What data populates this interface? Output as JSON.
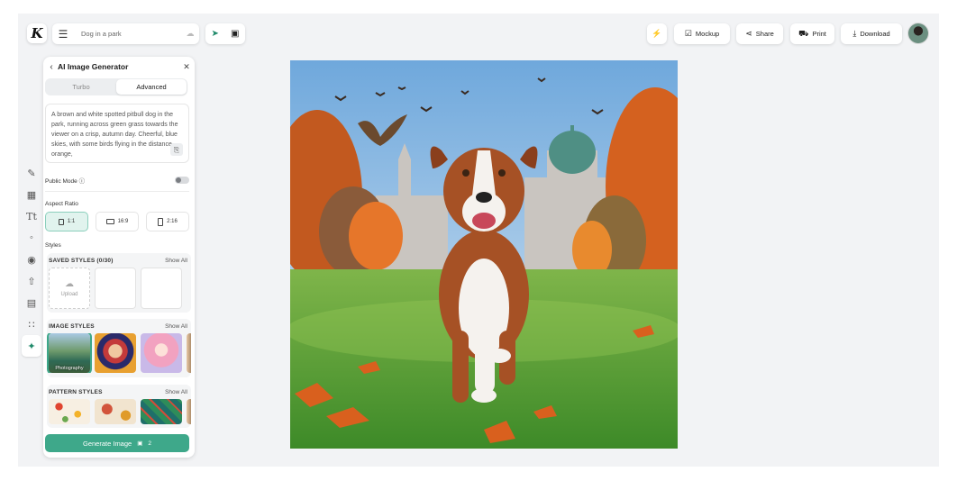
{
  "header": {
    "logo_letter": "K",
    "document_title": "Dog in a park",
    "menu_icon": "hamburger-icon",
    "cloud_icon": "cloud-icon",
    "tools": [
      "cursor-icon",
      "crop-icon"
    ],
    "buttons": {
      "mockup": "Mockup",
      "share": "Share",
      "print": "Print",
      "download": "Download"
    }
  },
  "rail": [
    "edit-icon",
    "layout-icon",
    "text-icon",
    "shapes-icon",
    "elements-icon",
    "upload-icon",
    "image-icon",
    "pattern-icon",
    "ai-sparkle-icon"
  ],
  "panel": {
    "title": "AI Image Generator",
    "tabs": {
      "turbo": "Turbo",
      "advanced": "Advanced"
    },
    "prompt_text": "A brown and white spotted pitbull dog in the park, running across green grass towards the viewer on a crisp, autumn day. Cheerful, blue skies, with some birds flying in the distance, orange,",
    "public_mode_label": "Public Mode",
    "public_mode_enabled": false,
    "aspect_ratio_label": "Aspect Ratio",
    "aspect_ratios": [
      "1:1",
      "16:9",
      "2:16"
    ],
    "aspect_selected": "1:1",
    "styles_label": "Styles",
    "saved_styles": {
      "title": "SAVED STYLES (0/30)",
      "show_all": "Show All",
      "upload_label": "Upload"
    },
    "image_styles": {
      "title": "IMAGE STYLES",
      "show_all": "Show All",
      "first_caption": "Photography"
    },
    "pattern_styles": {
      "title": "PATTERN STYLES",
      "show_all": "Show All"
    },
    "generate_label": "Generate Image",
    "generate_credits": "2"
  },
  "colors": {
    "accent": "#3ea88a",
    "selected_bg": "#e1f3ee",
    "alert": "#e0344a"
  }
}
